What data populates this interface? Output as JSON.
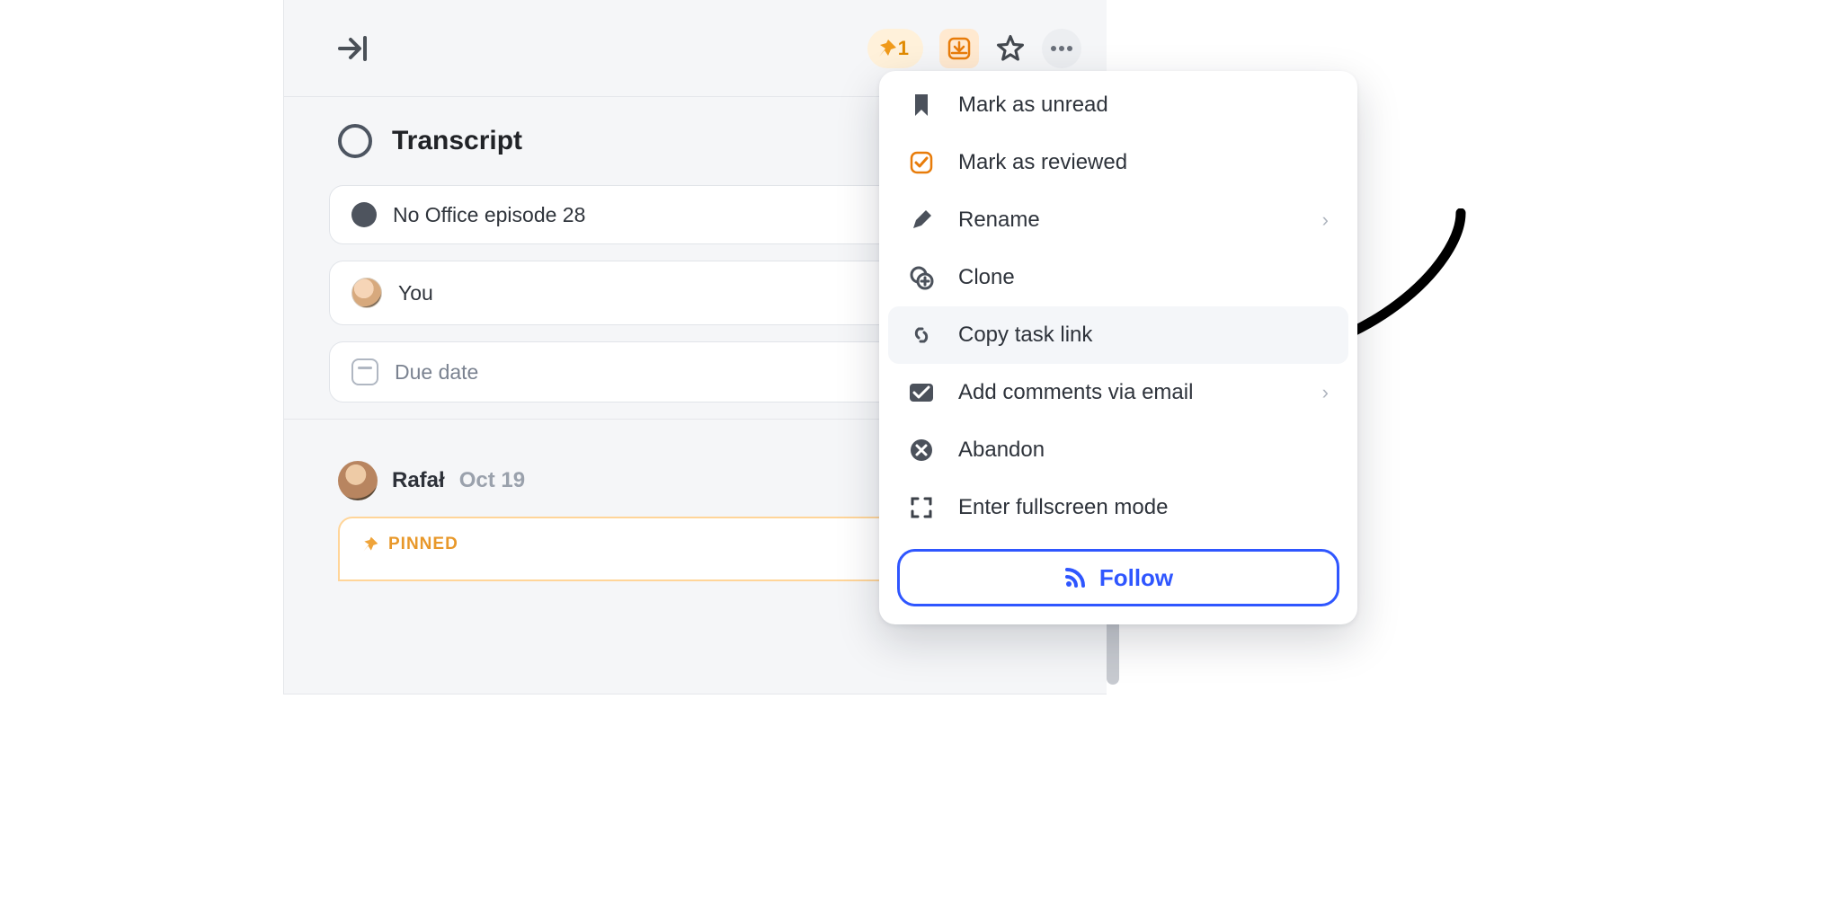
{
  "header": {
    "pin_count": "1"
  },
  "task": {
    "title": "Transcript",
    "project": "No Office episode 28",
    "assignee": "You",
    "due_date_placeholder": "Due date"
  },
  "comment": {
    "author": "Rafał",
    "date": "Oct 19",
    "pinned_label": "PINNED"
  },
  "menu": {
    "items": [
      "Mark as unread",
      "Mark as reviewed",
      "Rename",
      "Clone",
      "Copy task link",
      "Add comments via email",
      "Abandon",
      "Enter fullscreen mode"
    ],
    "follow": "Follow"
  }
}
